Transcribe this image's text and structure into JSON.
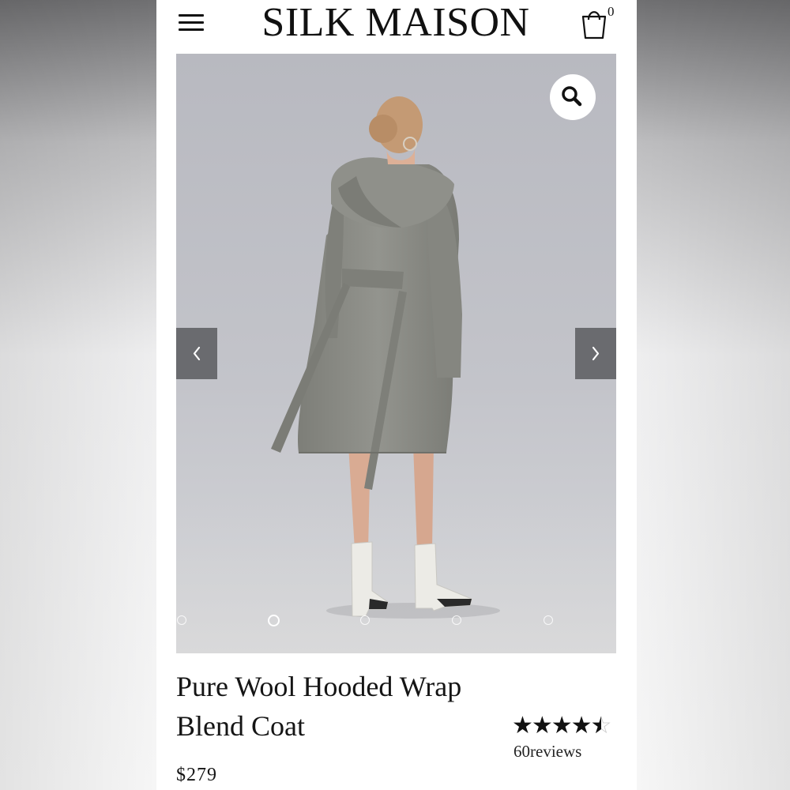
{
  "header": {
    "brand": "SILK MAISON",
    "cart_count": "0",
    "menu_icon": "hamburger-menu-icon",
    "cart_icon": "shopping-bag-icon"
  },
  "gallery": {
    "zoom_icon": "magnifier-icon",
    "prev_icon": "chevron-left-icon",
    "next_icon": "chevron-right-icon",
    "slide_count": 5,
    "active_slide": 2,
    "background_color": "#c2c3c9",
    "coat_color": "#8a8b85",
    "boot_color": "#ecebe6"
  },
  "product": {
    "title": "Pure Wool Hooded Wrap Blend Coat",
    "rating": 4.5,
    "rating_max": 5,
    "reviews_label": "60reviews",
    "price": "$279"
  }
}
